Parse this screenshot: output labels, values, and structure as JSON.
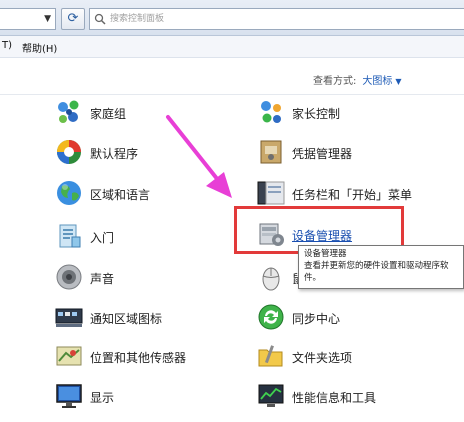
{
  "search": {
    "placeholder": "搜索控制面板"
  },
  "menu": [
    {
      "label": "T)"
    },
    {
      "label": "帮助(H)"
    }
  ],
  "view_by": {
    "label": "查看方式:",
    "value": "大图标"
  },
  "items_left": [
    {
      "label": "家庭组",
      "icon": "homegroup-icon"
    },
    {
      "label": "默认程序",
      "icon": "default-programs-icon"
    },
    {
      "label": "区域和语言",
      "icon": "region-language-icon"
    },
    {
      "label": "入门",
      "icon": "getting-started-icon"
    },
    {
      "label": "声音",
      "icon": "sound-icon"
    },
    {
      "label": "通知区域图标",
      "icon": "notification-area-icon"
    },
    {
      "label": "位置和其他传感器",
      "icon": "location-sensors-icon"
    },
    {
      "label": "显示",
      "icon": "display-icon"
    }
  ],
  "items_right": [
    {
      "label": "家长控制",
      "icon": "parental-controls-icon"
    },
    {
      "label": "凭据管理器",
      "icon": "credential-manager-icon"
    },
    {
      "label": "任务栏和「开始」菜单",
      "icon": "taskbar-start-icon"
    },
    {
      "label": "设备管理器",
      "icon": "device-manager-icon"
    },
    {
      "label": "鼠",
      "icon": "mouse-icon"
    },
    {
      "label": "同步中心",
      "icon": "sync-center-icon"
    },
    {
      "label": "文件夹选项",
      "icon": "folder-options-icon"
    },
    {
      "label": "性能信息和工具",
      "icon": "performance-tools-icon"
    }
  ],
  "tooltip": {
    "title": "设备管理器",
    "text": "查看并更新您的硬件设置和驱动程序软件。"
  },
  "colors": {
    "highlight": "#e23a3a",
    "arrow": "#e83fd6",
    "link": "#1a4fb0"
  }
}
